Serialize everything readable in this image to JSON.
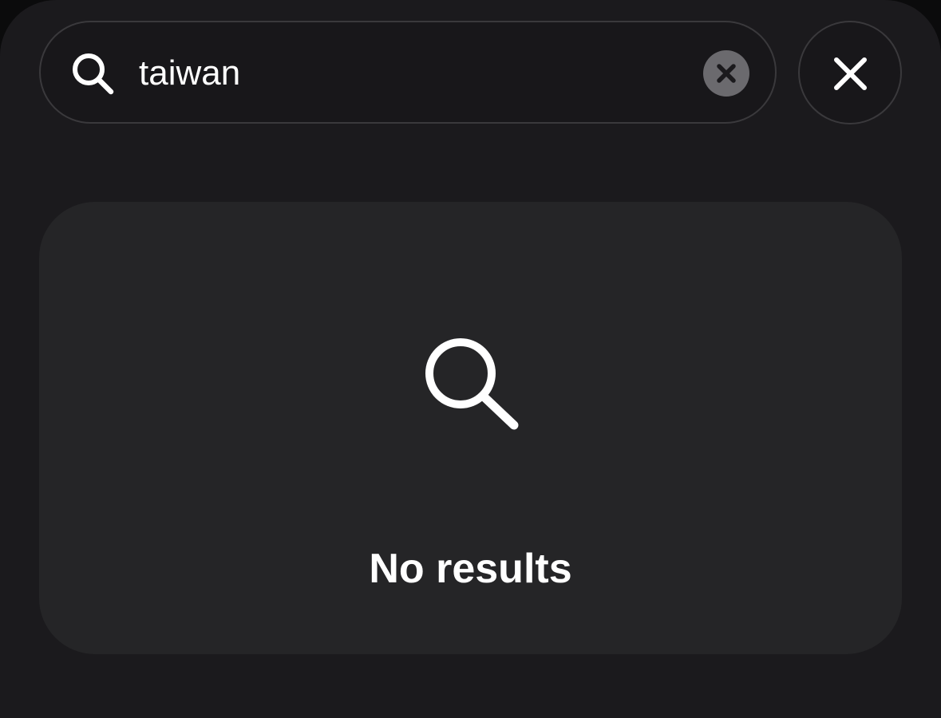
{
  "search": {
    "value": "taiwan",
    "icon": "search-icon",
    "clear_icon": "clear-icon"
  },
  "close": {
    "icon": "close-icon"
  },
  "results": {
    "empty_icon": "search-icon",
    "empty_message": "No results"
  },
  "colors": {
    "background": "#1b1a1d",
    "panel": "#252527",
    "field_border": "#3a393c",
    "clear_badge": "#6b6a6e",
    "text": "#ffffff"
  }
}
